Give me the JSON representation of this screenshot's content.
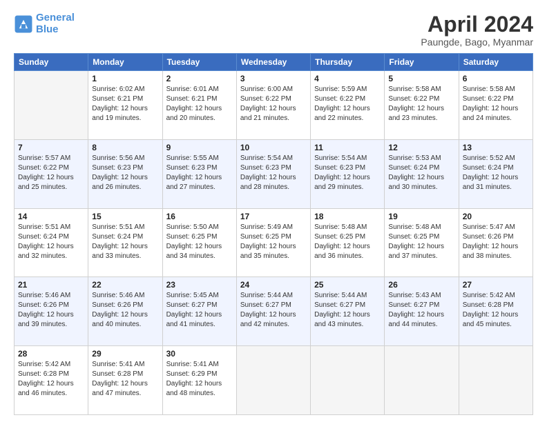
{
  "header": {
    "logo_line1": "General",
    "logo_line2": "Blue",
    "title": "April 2024",
    "subtitle": "Paungde, Bago, Myanmar"
  },
  "days_of_week": [
    "Sunday",
    "Monday",
    "Tuesday",
    "Wednesday",
    "Thursday",
    "Friday",
    "Saturday"
  ],
  "weeks": [
    [
      {
        "day": "",
        "info": ""
      },
      {
        "day": "1",
        "info": "Sunrise: 6:02 AM\nSunset: 6:21 PM\nDaylight: 12 hours\nand 19 minutes."
      },
      {
        "day": "2",
        "info": "Sunrise: 6:01 AM\nSunset: 6:21 PM\nDaylight: 12 hours\nand 20 minutes."
      },
      {
        "day": "3",
        "info": "Sunrise: 6:00 AM\nSunset: 6:22 PM\nDaylight: 12 hours\nand 21 minutes."
      },
      {
        "day": "4",
        "info": "Sunrise: 5:59 AM\nSunset: 6:22 PM\nDaylight: 12 hours\nand 22 minutes."
      },
      {
        "day": "5",
        "info": "Sunrise: 5:58 AM\nSunset: 6:22 PM\nDaylight: 12 hours\nand 23 minutes."
      },
      {
        "day": "6",
        "info": "Sunrise: 5:58 AM\nSunset: 6:22 PM\nDaylight: 12 hours\nand 24 minutes."
      }
    ],
    [
      {
        "day": "7",
        "info": "Sunrise: 5:57 AM\nSunset: 6:22 PM\nDaylight: 12 hours\nand 25 minutes."
      },
      {
        "day": "8",
        "info": "Sunrise: 5:56 AM\nSunset: 6:23 PM\nDaylight: 12 hours\nand 26 minutes."
      },
      {
        "day": "9",
        "info": "Sunrise: 5:55 AM\nSunset: 6:23 PM\nDaylight: 12 hours\nand 27 minutes."
      },
      {
        "day": "10",
        "info": "Sunrise: 5:54 AM\nSunset: 6:23 PM\nDaylight: 12 hours\nand 28 minutes."
      },
      {
        "day": "11",
        "info": "Sunrise: 5:54 AM\nSunset: 6:23 PM\nDaylight: 12 hours\nand 29 minutes."
      },
      {
        "day": "12",
        "info": "Sunrise: 5:53 AM\nSunset: 6:24 PM\nDaylight: 12 hours\nand 30 minutes."
      },
      {
        "day": "13",
        "info": "Sunrise: 5:52 AM\nSunset: 6:24 PM\nDaylight: 12 hours\nand 31 minutes."
      }
    ],
    [
      {
        "day": "14",
        "info": "Sunrise: 5:51 AM\nSunset: 6:24 PM\nDaylight: 12 hours\nand 32 minutes."
      },
      {
        "day": "15",
        "info": "Sunrise: 5:51 AM\nSunset: 6:24 PM\nDaylight: 12 hours\nand 33 minutes."
      },
      {
        "day": "16",
        "info": "Sunrise: 5:50 AM\nSunset: 6:25 PM\nDaylight: 12 hours\nand 34 minutes."
      },
      {
        "day": "17",
        "info": "Sunrise: 5:49 AM\nSunset: 6:25 PM\nDaylight: 12 hours\nand 35 minutes."
      },
      {
        "day": "18",
        "info": "Sunrise: 5:48 AM\nSunset: 6:25 PM\nDaylight: 12 hours\nand 36 minutes."
      },
      {
        "day": "19",
        "info": "Sunrise: 5:48 AM\nSunset: 6:25 PM\nDaylight: 12 hours\nand 37 minutes."
      },
      {
        "day": "20",
        "info": "Sunrise: 5:47 AM\nSunset: 6:26 PM\nDaylight: 12 hours\nand 38 minutes."
      }
    ],
    [
      {
        "day": "21",
        "info": "Sunrise: 5:46 AM\nSunset: 6:26 PM\nDaylight: 12 hours\nand 39 minutes."
      },
      {
        "day": "22",
        "info": "Sunrise: 5:46 AM\nSunset: 6:26 PM\nDaylight: 12 hours\nand 40 minutes."
      },
      {
        "day": "23",
        "info": "Sunrise: 5:45 AM\nSunset: 6:27 PM\nDaylight: 12 hours\nand 41 minutes."
      },
      {
        "day": "24",
        "info": "Sunrise: 5:44 AM\nSunset: 6:27 PM\nDaylight: 12 hours\nand 42 minutes."
      },
      {
        "day": "25",
        "info": "Sunrise: 5:44 AM\nSunset: 6:27 PM\nDaylight: 12 hours\nand 43 minutes."
      },
      {
        "day": "26",
        "info": "Sunrise: 5:43 AM\nSunset: 6:27 PM\nDaylight: 12 hours\nand 44 minutes."
      },
      {
        "day": "27",
        "info": "Sunrise: 5:42 AM\nSunset: 6:28 PM\nDaylight: 12 hours\nand 45 minutes."
      }
    ],
    [
      {
        "day": "28",
        "info": "Sunrise: 5:42 AM\nSunset: 6:28 PM\nDaylight: 12 hours\nand 46 minutes."
      },
      {
        "day": "29",
        "info": "Sunrise: 5:41 AM\nSunset: 6:28 PM\nDaylight: 12 hours\nand 47 minutes."
      },
      {
        "day": "30",
        "info": "Sunrise: 5:41 AM\nSunset: 6:29 PM\nDaylight: 12 hours\nand 48 minutes."
      },
      {
        "day": "",
        "info": ""
      },
      {
        "day": "",
        "info": ""
      },
      {
        "day": "",
        "info": ""
      },
      {
        "day": "",
        "info": ""
      }
    ]
  ]
}
